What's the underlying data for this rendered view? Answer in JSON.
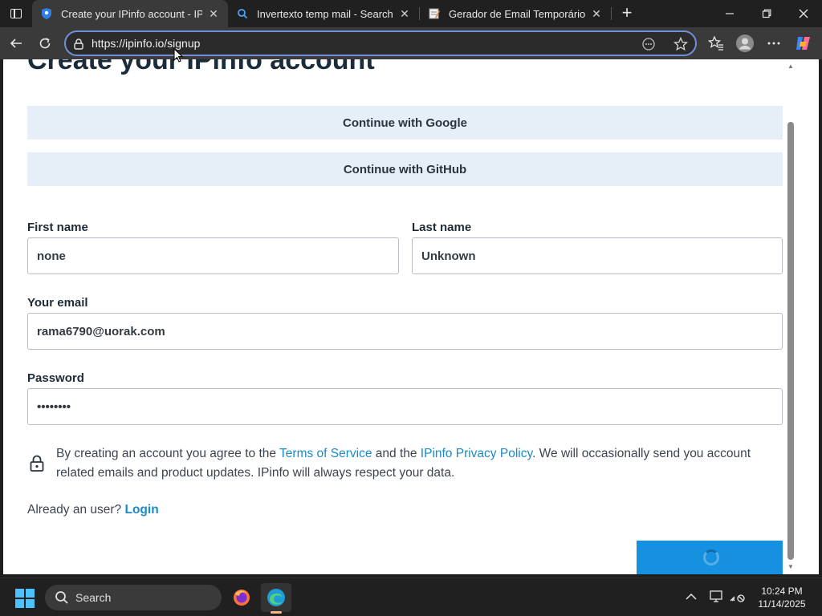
{
  "browser": {
    "tabs": [
      {
        "title": "Create your IPinfo account - IPinfo",
        "favicon": "ipinfo-shield-icon",
        "active": true
      },
      {
        "title": "Invertexto temp mail - Search",
        "favicon": "search-icon",
        "active": false
      },
      {
        "title": "Gerador de Email Temporário | invertexto",
        "favicon": "notepad-icon",
        "active": false
      }
    ],
    "url": "https://ipinfo.io/signup"
  },
  "page": {
    "heading": "Create your IPinfo account",
    "google_button": "Continue with Google",
    "github_button": "Continue with GitHub",
    "first_name": {
      "label": "First name",
      "value": "none"
    },
    "last_name": {
      "label": "Last name",
      "value": "Unknown"
    },
    "email": {
      "label": "Your email",
      "value": "rama6790@uorak.com"
    },
    "password": {
      "label": "Password",
      "value": "••••••••"
    },
    "consent": {
      "pre": "By creating an account you agree to the ",
      "tos_link": "Terms of Service",
      "mid": " and the ",
      "privacy_link": "IPinfo Privacy Policy",
      "post": ". We will occasionally send you account related emails and product updates. IPinfo will always respect your data."
    },
    "already": {
      "text": "Already an user? ",
      "link": "Login"
    },
    "submit_state": "loading"
  },
  "taskbar": {
    "search_label": "Search",
    "time": "10:24 PM",
    "date": "11/14/2025"
  },
  "colors": {
    "accent": "#1591e0",
    "link": "#1a8acb",
    "sso_bg": "#e6eef7"
  }
}
